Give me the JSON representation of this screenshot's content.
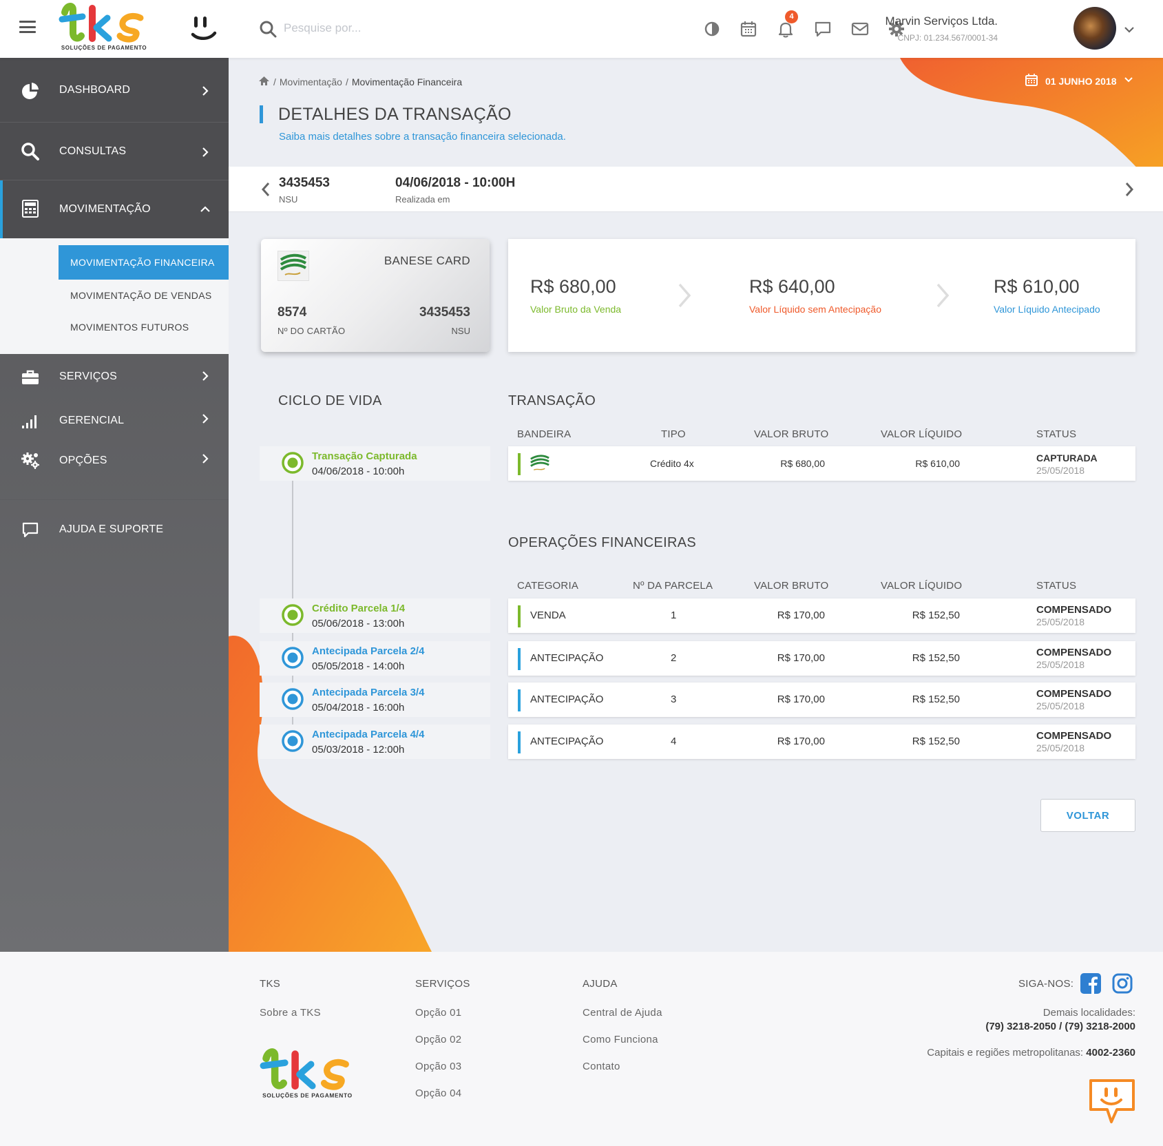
{
  "header": {
    "search_placeholder": "Pesquise por...",
    "notification_count": "4",
    "user_name": "Marvin Serviços Ltda.",
    "user_cnpj": "CNPJ: 01.234.567/0001-34",
    "logo_tagline": "SOLUÇÕES DE PAGAMENTO",
    "icons": [
      "menu-icon",
      "search-icon",
      "contrast-icon",
      "calendar-icon",
      "bell-icon",
      "chat-icon",
      "mail-icon",
      "gear-icon",
      "chevron-down-icon"
    ]
  },
  "sidebar": {
    "items": [
      {
        "label": "DASHBOARD",
        "icon": "pie-chart-icon"
      },
      {
        "label": "CONSULTAS",
        "icon": "search-icon"
      },
      {
        "label": "MOVIMENTAÇÃO",
        "icon": "calculator-icon"
      },
      {
        "label": "SERVIÇOS",
        "icon": "briefcase-icon"
      },
      {
        "label": "GERENCIAL",
        "icon": "signal-bars-icon"
      },
      {
        "label": "OPÇÕES",
        "icon": "gears-icon"
      },
      {
        "label": "AJUDA E SUPORTE",
        "icon": "chat-icon"
      }
    ],
    "submenu": [
      "MOVIMENTAÇÃO FINANCEIRA",
      "MOVIMENTAÇÃO DE VENDAS",
      "MOVIMENTOS FUTUROS"
    ]
  },
  "breadcrumb": {
    "sep": "/",
    "level1": "Movimentação",
    "level2": "Movimentação Financeira"
  },
  "date_picker": "01 JUNHO 2018",
  "page": {
    "title": "DETALHES DA TRANSAÇÃO",
    "subtitle": "Saiba mais detalhes sobre a transação financeira selecionada."
  },
  "transaction_bar": {
    "nsu": "3435453",
    "nsu_label": "NSU",
    "datetime": "04/06/2018 - 10:00H",
    "datetime_label": "Realizada em"
  },
  "card": {
    "brand": "BANESE CARD",
    "number": "8574",
    "number_label": "Nº DO CARTÃO",
    "nsu": "3435453",
    "nsu_label": "NSU"
  },
  "values": [
    {
      "amount": "R$ 680,00",
      "label": "Valor Bruto da Venda",
      "color": "#7cb92c"
    },
    {
      "amount": "R$ 640,00",
      "label": "Valor Líquido sem Antecipação",
      "color": "#ef5a2b"
    },
    {
      "amount": "R$ 610,00",
      "label": "Valor Líquido Antecipado",
      "color": "#2f96d8"
    }
  ],
  "lifecycle": {
    "title": "CICLO DE VIDA",
    "items": [
      {
        "title": "Transação Capturada",
        "date": "04/06/2018 - 10:00h",
        "color": "#7cb92c"
      },
      {
        "title": "Crédito Parcela 1/4",
        "date": "05/06/2018 - 13:00h",
        "color": "#7cb92c"
      },
      {
        "title": "Antecipada Parcela 2/4",
        "date": "05/05/2018 - 14:00h",
        "color": "#2f96d8"
      },
      {
        "title": "Antecipada Parcela 3/4",
        "date": "05/04/2018 - 16:00h",
        "color": "#2f96d8"
      },
      {
        "title": "Antecipada Parcela 4/4",
        "date": "05/03/2018 - 12:00h",
        "color": "#2f96d8"
      }
    ]
  },
  "transaction": {
    "title": "TRANSAÇÃO",
    "headers": [
      "BANDEIRA",
      "TIPO",
      "VALOR BRUTO",
      "VALOR LÍQUIDO",
      "STATUS"
    ],
    "row": {
      "brand_icon": "banese-card-icon",
      "tipo": "Crédito 4x",
      "bruto": "R$ 680,00",
      "liquido": "R$ 610,00",
      "status": "CAPTURADA",
      "status_date": "25/05/2018"
    }
  },
  "operations": {
    "title": "OPERAÇÕES FINANCEIRAS",
    "headers": [
      "CATEGORIA",
      "Nº DA PARCELA",
      "VALOR BRUTO",
      "VALOR LÍQUIDO",
      "STATUS"
    ],
    "rows": [
      {
        "categoria": "VENDA",
        "parcela": "1",
        "bruto": "R$ 170,00",
        "liquido": "R$ 152,50",
        "status": "COMPENSADO",
        "status_date": "25/05/2018",
        "accent": "#7cb92c"
      },
      {
        "categoria": "ANTECIPAÇÃO",
        "parcela": "2",
        "bruto": "R$ 170,00",
        "liquido": "R$ 152,50",
        "status": "COMPENSADO",
        "status_date": "25/05/2018",
        "accent": "#2aa1dd"
      },
      {
        "categoria": "ANTECIPAÇÃO",
        "parcela": "3",
        "bruto": "R$ 170,00",
        "liquido": "R$ 152,50",
        "status": "COMPENSADO",
        "status_date": "25/05/2018",
        "accent": "#2aa1dd"
      },
      {
        "categoria": "ANTECIPAÇÃO",
        "parcela": "4",
        "bruto": "R$ 170,00",
        "liquido": "R$ 152,50",
        "status": "COMPENSADO",
        "status_date": "25/05/2018",
        "accent": "#2aa1dd"
      }
    ]
  },
  "back_button": "VOLTAR",
  "footer": {
    "col1": {
      "title": "TKS",
      "links": [
        "Sobre a TKS"
      ]
    },
    "col2": {
      "title": "SERVIÇOS",
      "links": [
        "Opção 01",
        "Opção 02",
        "Opção 03",
        "Opção 04"
      ]
    },
    "col3": {
      "title": "AJUDA",
      "links": [
        "Central de Ajuda",
        "Como Funciona",
        "Contato"
      ]
    },
    "follow_label": "SIGA-NOS:",
    "contact_label1": "Demais localidades:",
    "contact_phones": "(79) 3218-2050 / (79) 3218-2000",
    "contact_label2": "Capitais e regiões metropolitanas:",
    "contact_capital": "4002-2360"
  },
  "colors": {
    "accent_blue": "#2f96d8",
    "accent_green": "#7cb92c",
    "accent_orange": "#ef5a2b",
    "sidebar": "#5a5a5d"
  }
}
